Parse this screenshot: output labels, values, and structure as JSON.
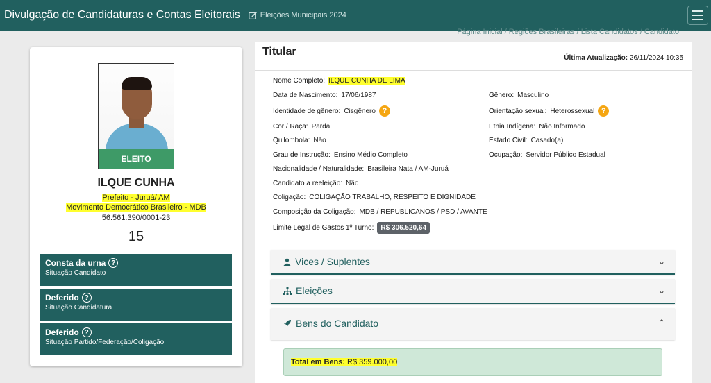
{
  "topbar": {
    "title": "Divulgação de Candidaturas e Contas Eleitorais",
    "subtitle": "Eleições Municipais 2024"
  },
  "breadcrumb": "Página Inicial / Regiões Brasileiras / Lista Candidatos / Candidato",
  "candidate": {
    "badge": "ELEITO",
    "name": "ILQUE CUNHA",
    "office": "Prefeito - Juruá/ AM",
    "party": "Movimento Democrático Brasileiro - MDB",
    "cnpj": "56.561.390/0001-23",
    "number": "15",
    "statuses": [
      {
        "title": "Consta da urna",
        "subtitle": "Situação Candidato"
      },
      {
        "title": "Deferido",
        "subtitle": "Situação Candidatura"
      },
      {
        "title": "Deferido",
        "subtitle": "Situação Partido/Federação/Coligação"
      }
    ]
  },
  "details": {
    "title": "Titular",
    "updated_label": "Última Atualização:",
    "updated_value": "26/11/2024 10:35",
    "fields": {
      "nome": {
        "label": "Nome Completo:",
        "value": "ILQUE CUNHA DE LIMA"
      },
      "nasc": {
        "label": "Data de Nascimento:",
        "value": "17/06/1987"
      },
      "genero": {
        "label": "Gênero:",
        "value": "Masculino"
      },
      "identidade": {
        "label": "Identidade de gênero:",
        "value": "Cisgênero"
      },
      "orientacao": {
        "label": "Orientação sexual:",
        "value": "Heterossexual"
      },
      "cor": {
        "label": "Cor / Raça:",
        "value": "Parda"
      },
      "etnia": {
        "label": "Etnia Indígena:",
        "value": "Não Informado"
      },
      "quilombola": {
        "label": "Quilombola:",
        "value": "Não"
      },
      "civil": {
        "label": "Estado Civil:",
        "value": "Casado(a)"
      },
      "instrucao": {
        "label": "Grau de Instrução:",
        "value": "Ensino Médio Completo"
      },
      "ocupacao": {
        "label": "Ocupação:",
        "value": "Servidor Público Estadual"
      },
      "nacionalidade": {
        "label": "Nacionalidade / Naturalidade:",
        "value": "Brasileira Nata / AM-Juruá"
      },
      "reeleicao": {
        "label": "Candidato a reeleição:",
        "value": "Não"
      },
      "coligacao": {
        "label": "Coligação:",
        "value": "COLIGAÇÃO TRABALHO, RESPEITO E DIGNIDADE"
      },
      "composicao": {
        "label": "Composição da Coligação:",
        "value": "MDB / REPUBLICANOS / PSD / AVANTE"
      },
      "limite": {
        "label": "Limite Legal de Gastos 1º Turno:",
        "value": "R$ 306.520,64"
      }
    },
    "help_glyph": "?"
  },
  "accordions": {
    "vices": "Vices / Suplentes",
    "eleicoes": "Eleições",
    "bens": "Bens do Candidato",
    "chevron_down": "⌄",
    "chevron_up": "⌃"
  },
  "bens": {
    "total_label": "Total em Bens:",
    "total_value": "R$ 359.000,00"
  }
}
